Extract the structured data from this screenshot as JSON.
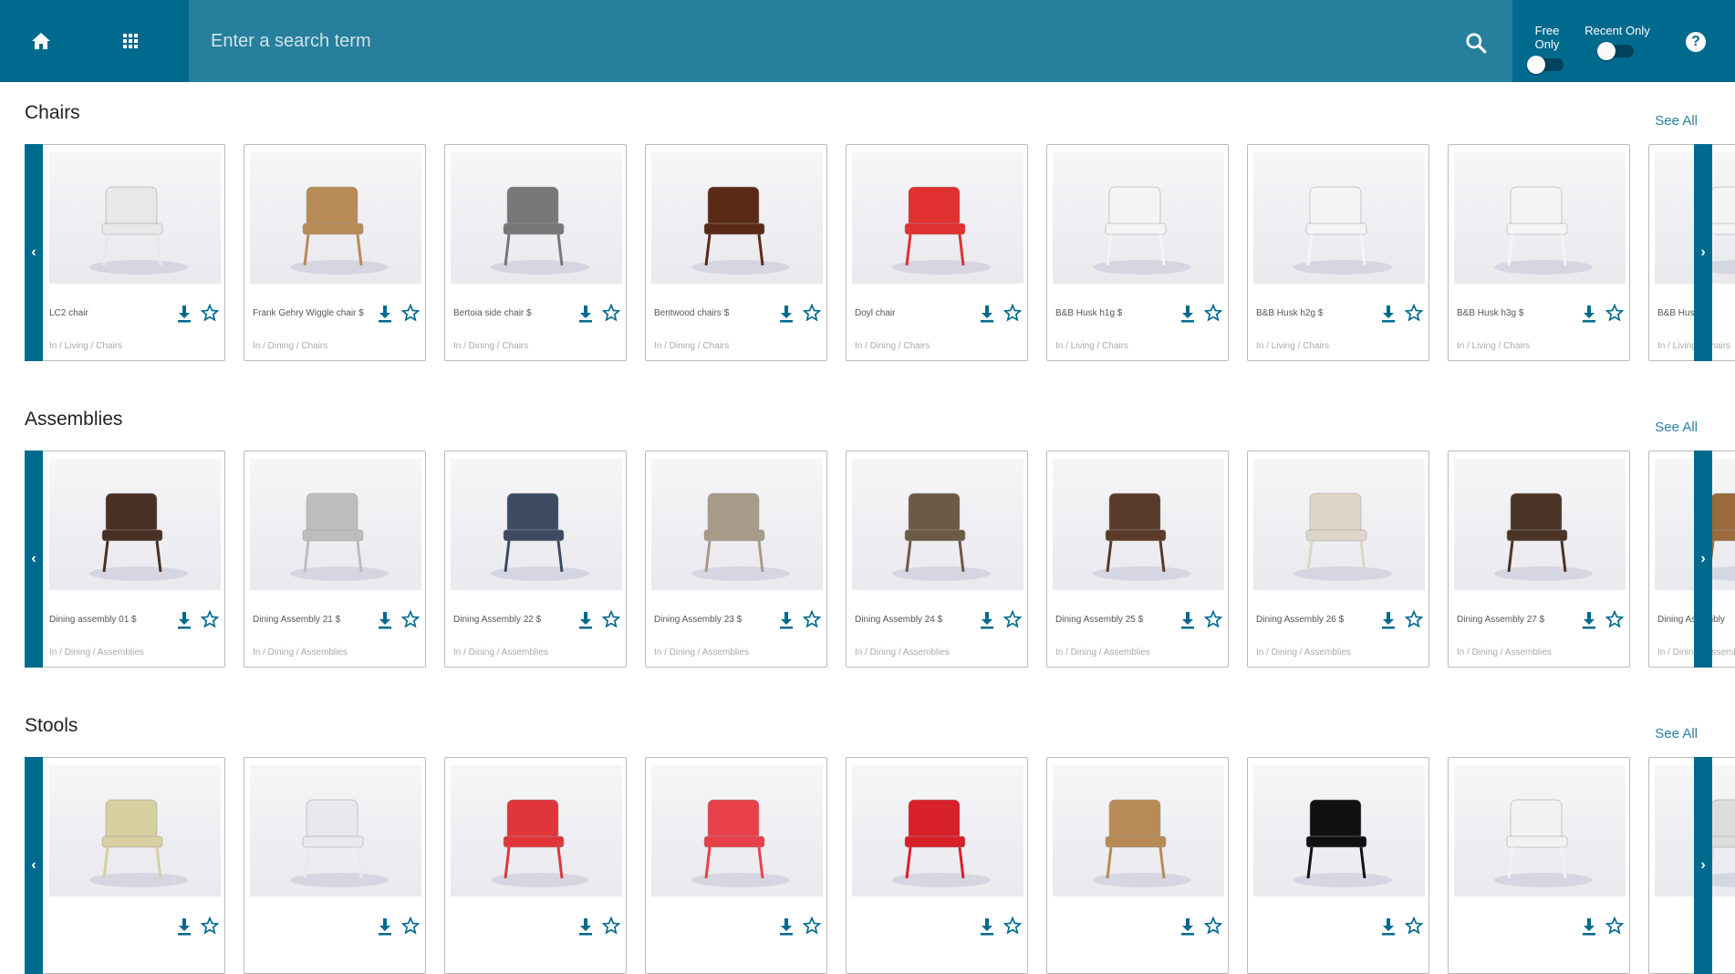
{
  "header": {
    "home_icon": "home-icon",
    "apps_icon": "grid-icon",
    "search_placeholder": "Enter a search term",
    "search_icon": "search-icon",
    "toggles": [
      {
        "label": "Free Only",
        "on": false
      },
      {
        "label": "Recent Only",
        "on": false
      }
    ],
    "help_label": "?"
  },
  "colors": {
    "primary": "#006a8e",
    "search_bg": "#267f9c",
    "toggle_track": "#00435a",
    "link": "#2a7fa0"
  },
  "sections": [
    {
      "title": "Chairs",
      "see_all": "See All",
      "items": [
        {
          "name": "LC2 chair",
          "category": "In / Living / Chairs",
          "tint": "#e8e8e8"
        },
        {
          "name": "Frank Gehry Wiggle chair $",
          "category": "In / Dining / Chairs",
          "tint": "#b88a55"
        },
        {
          "name": "Bertoia side chair $",
          "category": "In / Dining / Chairs",
          "tint": "#777777"
        },
        {
          "name": "Bentwood chairs $",
          "category": "In / Dining / Chairs",
          "tint": "#5a2a16"
        },
        {
          "name": "Doyl chair",
          "category": "In / Dining / Chairs",
          "tint": "#e0302f"
        },
        {
          "name": "B&B Husk h1g $",
          "category": "In / Living / Chairs",
          "tint": "#f4f4f4"
        },
        {
          "name": "B&B Husk h2g $",
          "category": "In / Living / Chairs",
          "tint": "#f4f4f4"
        },
        {
          "name": "B&B Husk h3g $",
          "category": "In / Living / Chairs",
          "tint": "#f4f4f4"
        },
        {
          "name": "B&B Husk",
          "category": "In / Living / Chairs",
          "tint": "#f4f4f4"
        }
      ]
    },
    {
      "title": "Assemblies",
      "see_all": "See All",
      "items": [
        {
          "name": "Dining assembly 01 $",
          "category": "In / Dining / Assemblies",
          "tint": "#4a3024"
        },
        {
          "name": "Dining Assembly 21 $",
          "category": "In / Dining / Assemblies",
          "tint": "#bdbdbd"
        },
        {
          "name": "Dining Assembly 22 $",
          "category": "In / Dining / Assemblies",
          "tint": "#3c4a62"
        },
        {
          "name": "Dining Assembly 23 $",
          "category": "In / Dining / Assemblies",
          "tint": "#a89a88"
        },
        {
          "name": "Dining Assembly 24 $",
          "category": "In / Dining / Assemblies",
          "tint": "#6b5a46"
        },
        {
          "name": "Dining Assembly 25 $",
          "category": "In / Dining / Assemblies",
          "tint": "#5a3a28"
        },
        {
          "name": "Dining Assembly 26 $",
          "category": "In / Dining / Assemblies",
          "tint": "#ddd6c8"
        },
        {
          "name": "Dining Assembly 27 $",
          "category": "In / Dining / Assemblies",
          "tint": "#4a3426"
        },
        {
          "name": "Dining Assembly",
          "category": "In / Dining / Assemblies",
          "tint": "#9a6a3a"
        }
      ]
    },
    {
      "title": "Stools",
      "see_all": "See All",
      "items": [
        {
          "name": "",
          "category": "",
          "tint": "#d8d0a0"
        },
        {
          "name": "",
          "category": "",
          "tint": "#e8e8ee"
        },
        {
          "name": "",
          "category": "",
          "tint": "#e0353a"
        },
        {
          "name": "",
          "category": "",
          "tint": "#e8404a"
        },
        {
          "name": "",
          "category": "",
          "tint": "#d8202a"
        },
        {
          "name": "",
          "category": "",
          "tint": "#b88a55"
        },
        {
          "name": "",
          "category": "",
          "tint": "#111111"
        },
        {
          "name": "",
          "category": "",
          "tint": "#f2f2f2"
        },
        {
          "name": "",
          "category": "",
          "tint": "#dddddd"
        }
      ]
    }
  ]
}
